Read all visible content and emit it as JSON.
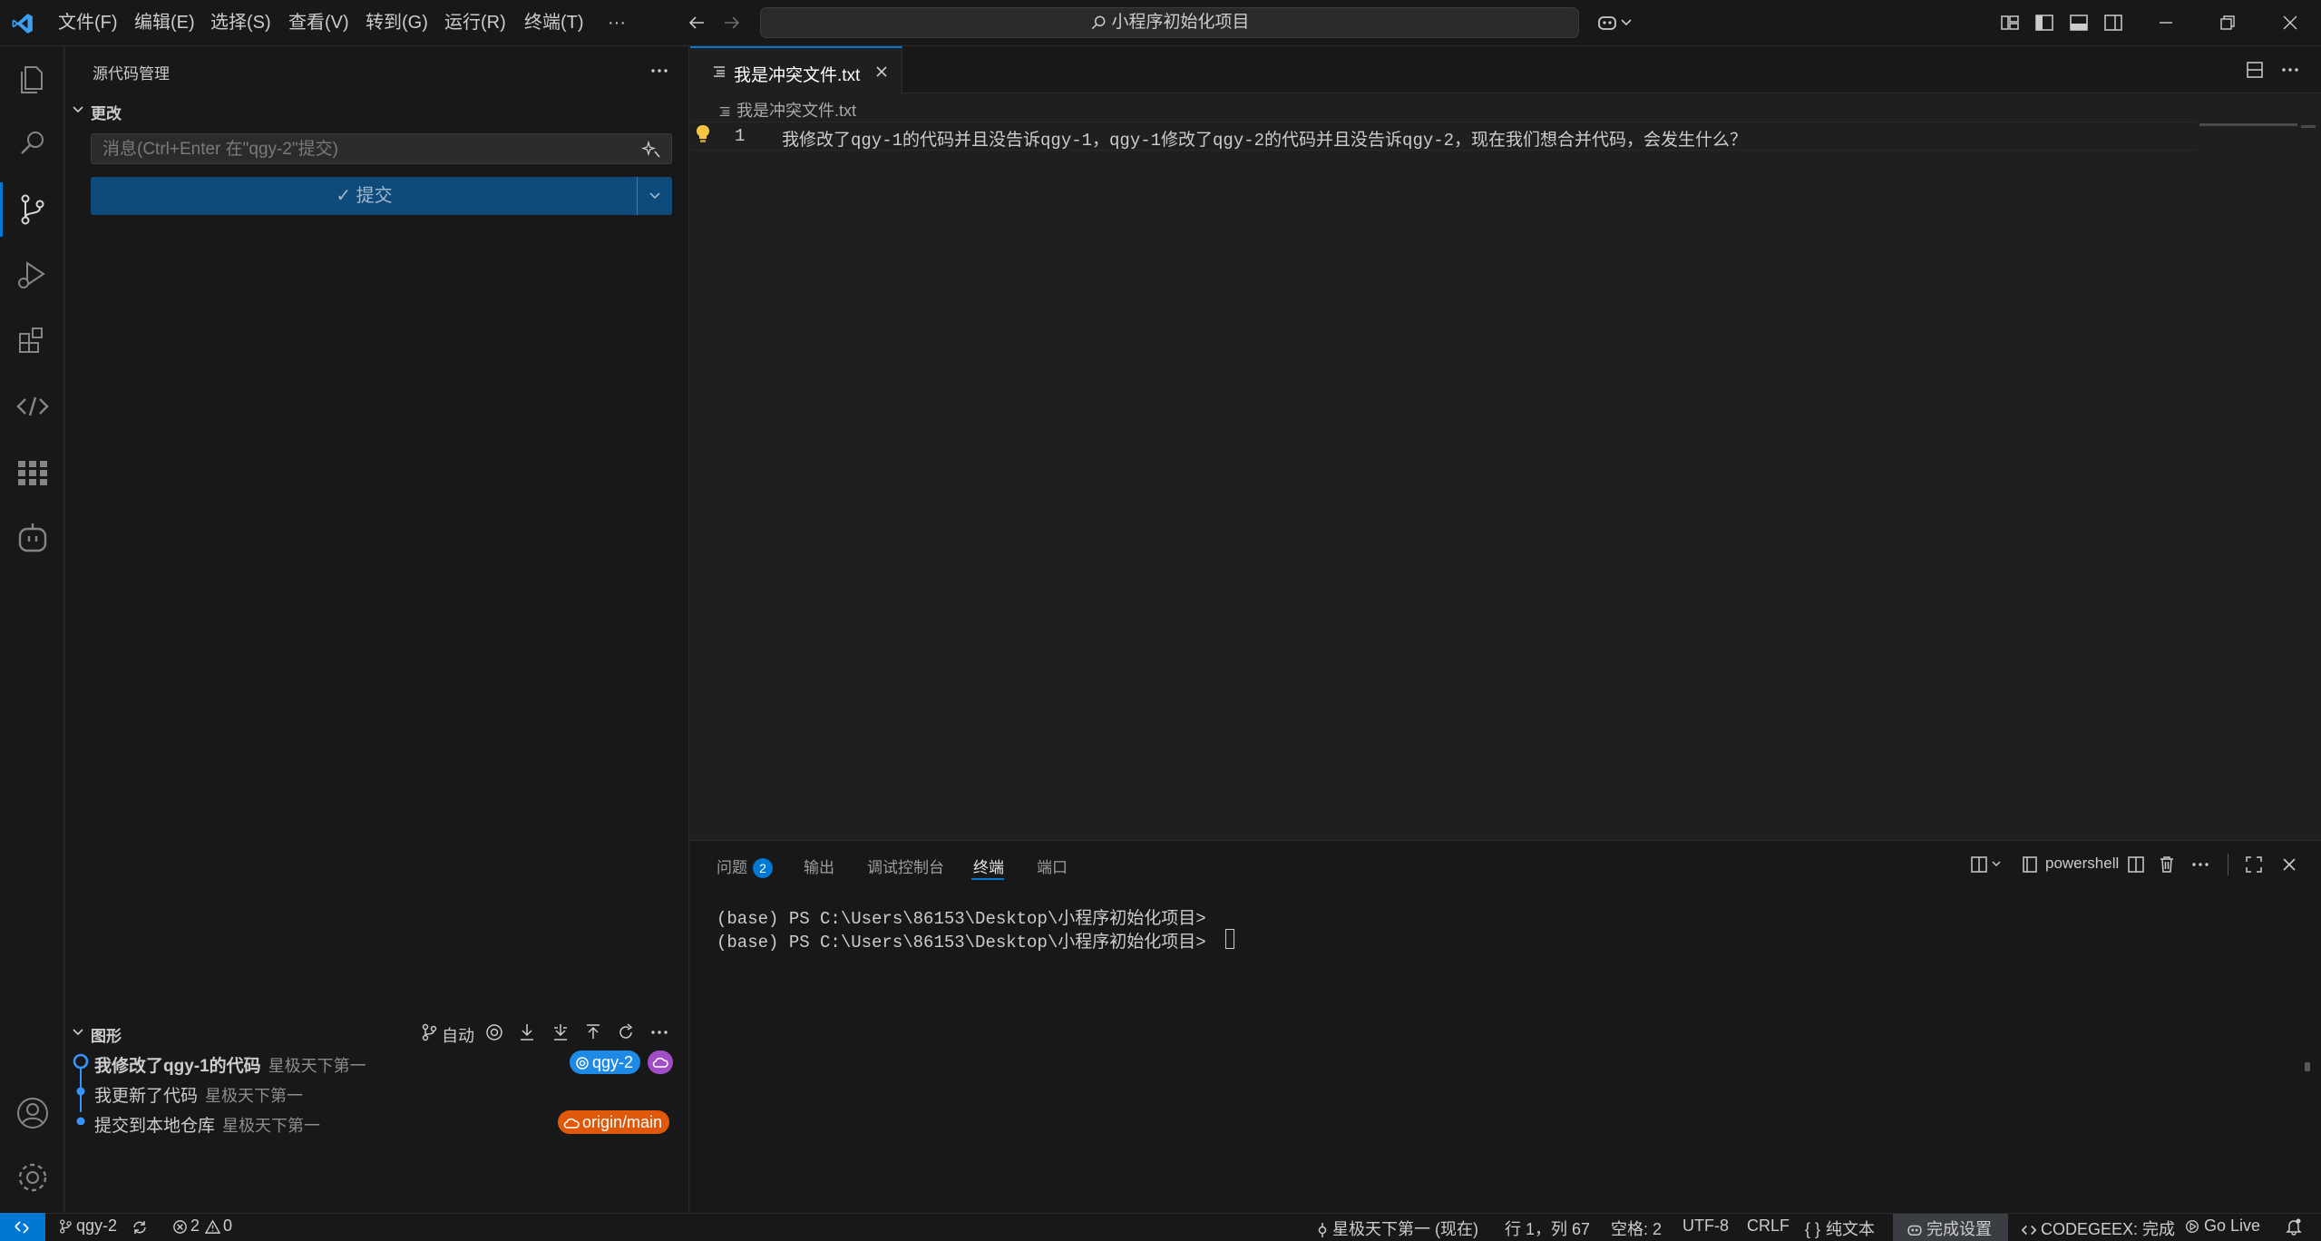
{
  "menu": {
    "items": [
      "文件(F)",
      "编辑(E)",
      "选择(S)",
      "查看(V)",
      "转到(G)",
      "运行(R)",
      "终端(T)"
    ],
    "more": "···"
  },
  "command_center": {
    "text": "小程序初始化项目"
  },
  "sidebar": {
    "title": "源代码管理",
    "changes_header": "更改",
    "commit_placeholder": "消息(Ctrl+Enter 在\"qgy-2\"提交)",
    "commit_button": "✓ 提交",
    "graph_header": "图形",
    "graph_auto": "自动",
    "graph": [
      {
        "message": "我修改了qgy-1的代码",
        "author": "星极天下第一",
        "badge": "qgy-2"
      },
      {
        "message": "我更新了代码",
        "author": "星极天下第一"
      },
      {
        "message": "提交到本地仓库",
        "author": "星极天下第一",
        "badge": "origin/main"
      }
    ]
  },
  "editor": {
    "tab_label": "我是冲突文件.txt",
    "breadcrumb": "我是冲突文件.txt",
    "line_number": "1",
    "line_text": "我修改了qgy-1的代码并且没告诉qgy-1，qgy-1修改了qgy-2的代码并且没告诉qgy-2，现在我们想合并代码，会发生什么？"
  },
  "panel": {
    "tabs": [
      "问题",
      "输出",
      "调试控制台",
      "终端",
      "端口"
    ],
    "problems_count": "2",
    "active_tab": "终端",
    "shell": "powershell",
    "terminal_lines": [
      "(base) PS C:\\Users\\86153\\Desktop\\小程序初始化项目>",
      "(base) PS C:\\Users\\86153\\Desktop\\小程序初始化项目>"
    ]
  },
  "statusbar": {
    "branch": "qgy-2",
    "errors": "2",
    "warnings": "0",
    "author": "星极天下第一 (现在)",
    "position": "行 1，列 67",
    "spaces": "空格: 2",
    "encoding": "UTF-8",
    "eol": "CRLF",
    "language": "纯文本",
    "copilot": "完成设置",
    "codegeex": "CODEGEEX: 完成",
    "golive": "Go Live"
  },
  "colors": {
    "accent": "#0078d4",
    "commit_button": "#0e4a7a",
    "badge_branch": "#1e8ae6",
    "badge_origin": "#e0580a",
    "badge_cloud": "#a04ec7"
  },
  "icons": {
    "activity": [
      "explorer-icon",
      "search-icon",
      "source-control-icon",
      "run-debug-icon",
      "extensions-icon",
      "remote-icon",
      "grid-icon",
      "copilot-icon",
      "account-icon",
      "gear-icon"
    ]
  }
}
